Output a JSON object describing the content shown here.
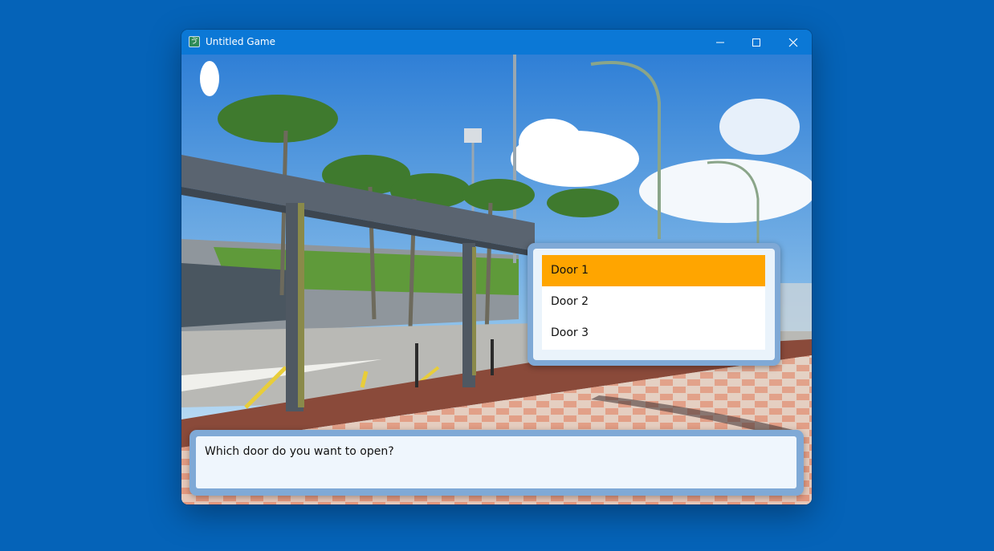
{
  "window": {
    "title": "Untitled Game",
    "icon": "app-icon",
    "controls": [
      "minimize-icon",
      "maximize-icon",
      "close-icon"
    ]
  },
  "choices": {
    "items": [
      {
        "label": "Door 1",
        "selected": true
      },
      {
        "label": "Door 2",
        "selected": false
      },
      {
        "label": "Door 3",
        "selected": false
      }
    ],
    "selected_color": "#ffa500"
  },
  "message": {
    "text": "Which door do you want to open?"
  },
  "colors": {
    "desktop": "#0563b8",
    "titlebar": "#0b78d6",
    "frame": "#7fa9d6"
  }
}
